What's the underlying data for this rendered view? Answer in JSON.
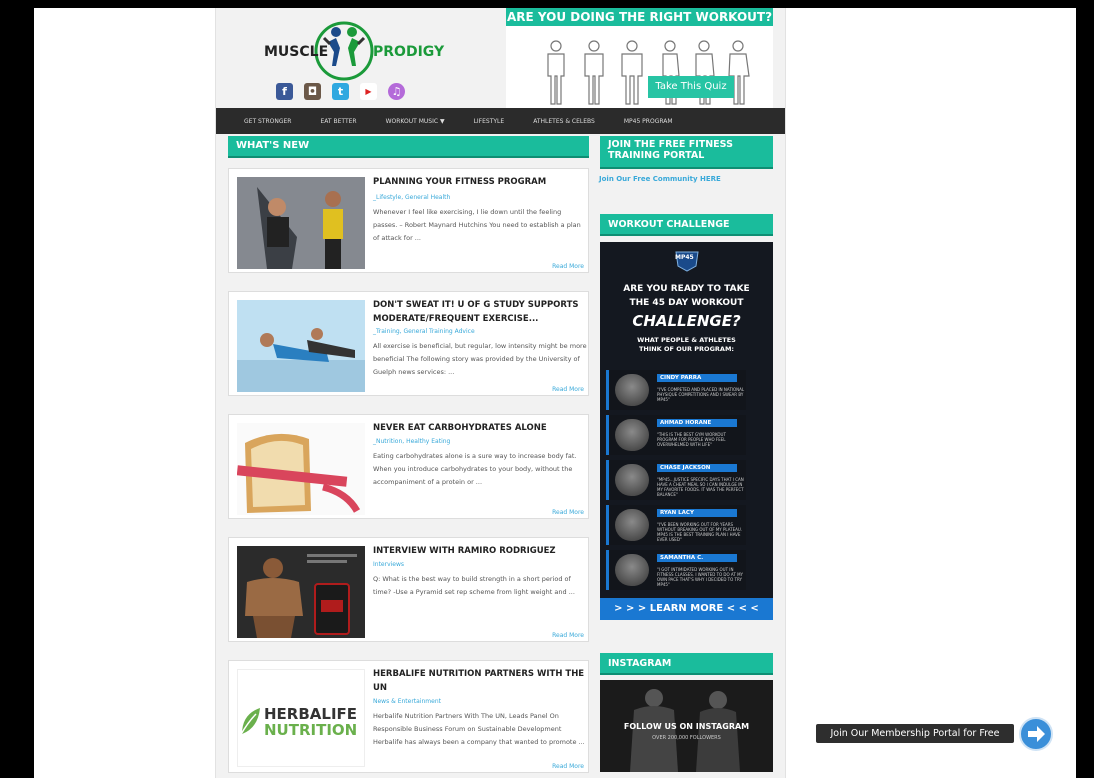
{
  "header": {
    "logo_word1": "MUSCLE",
    "logo_word2": "PRODIGY",
    "social_icons": [
      "facebook-icon",
      "instagram-icon",
      "twitter-icon",
      "youtube-icon",
      "itunes-icon"
    ],
    "quiz_banner": {
      "title": "ARE YOU DOING THE RIGHT WORKOUT?",
      "button_label": "Take This Quiz"
    }
  },
  "nav": {
    "items": [
      "GET STRONGER",
      "EAT BETTER",
      "WORKOUT MUSIC  ▼",
      "LIFESTYLE",
      "ATHLETES & CELEBS",
      "MP45 PROGRAM"
    ]
  },
  "main": {
    "section_title": "WHAT'S NEW",
    "posts": [
      {
        "title": "PLANNING YOUR FITNESS PROGRAM",
        "categories": "_Lifestyle, General Health",
        "excerpt": "Whenever I feel like exercising, I lie down until the feeling passes. – Robert Maynard Hutchins You need to establish a plan of attack for ...",
        "more": "Read More"
      },
      {
        "title": "DON'T SWEAT IT! U OF G STUDY SUPPORTS MODERATE/FREQUENT EXERCISE...",
        "categories": "_Training, General Training Advice",
        "excerpt": "All exercise is beneficial, but regular, low intensity might be more beneficial  The following story was provided by the University of Guelph news services: ...",
        "more": "Read More"
      },
      {
        "title": "NEVER EAT CARBOHYDRATES ALONE",
        "categories": "_Nutrition, Healthy Eating",
        "excerpt": "Eating carbohydrates alone is a sure way to increase body fat. When you introduce carbohydrates to your body, without the accompaniment of a protein or ...",
        "more": "Read More"
      },
      {
        "title": "INTERVIEW WITH RAMIRO RODRIGUEZ",
        "categories": "Interviews",
        "excerpt": "Q: What is the best way to build strength in a short period of time? -Use a Pyramid set rep scheme from light weight and ...",
        "more": "Read More"
      },
      {
        "title": "HERBALIFE NUTRITION PARTNERS WITH THE UN",
        "categories": "News & Entertainment",
        "excerpt": "Herbalife Nutrition Partners With The UN, Leads Panel On Responsible Business Forum on Sustainable Development Herbalife has always been a company that wanted to promote ...",
        "more": "Read More",
        "thumb_line1": "HERBALIFE",
        "thumb_line2": "NUTRITION"
      }
    ]
  },
  "sidebar": {
    "portal_title": "JOIN THE FREE FITNESS TRAINING PORTAL",
    "portal_link": "Join Our Free Community HERE",
    "challenge_title": "WORKOUT CHALLENGE",
    "challenge_ad": {
      "badge": "MP45",
      "line1": "ARE YOU READY TO TAKE",
      "line2": "THE 45 DAY WORKOUT",
      "line3": "CHALLENGE?",
      "line4": "WHAT PEOPLE & ATHLETES",
      "line5": "THINK OF OUR PROGRAM:",
      "testimonials": [
        {
          "name": "CINDY PARRA",
          "quote": "\"I'VE COMPETED AND PLACED IN NATIONAL PHYSIQUE COMPETITIONS AND I SWEAR BY MP45\""
        },
        {
          "name": "AHMAD HORANE",
          "quote": "\"THIS IS THE BEST GYM WORKOUT PROGRAM FOR PEOPLE WHO FEEL OVERWHELMED WITH LIFE\""
        },
        {
          "name": "CHASE JACKSON",
          "quote": "\"MP45...JUSTICE SPECIFIC DAYS THAT I CAN HAVE A CHEAT MEAL SO I CAN INDULGE IN MY FAVORITE FOODS. IT WAS THE PERFECT BALANCE\""
        },
        {
          "name": "RYAN LACY",
          "quote": "\"I'VE BEEN WORKING OUT FOR YEARS WITHOUT BREAKING OUT OF MY PLATEAU. MP45 IS THE BEST TRAINING PLAN I HAVE EVER USED\""
        },
        {
          "name": "SAMANTHA C.",
          "quote": "\"I GOT INTIMIDATED WORKING OUT IN FITNESS CLASSES. I WANTED TO DO AT MY OWN PACE THAT'S WHY I DECIDED TO TRY MP45\""
        }
      ],
      "cta": "> > > LEARN MORE < < <"
    },
    "instagram_title": "INSTAGRAM",
    "instagram_line1": "FOLLOW US ON INSTAGRAM",
    "instagram_line2": "OVER 200,000 FOLLOWERS"
  },
  "membership": {
    "label": "Join Our Membership Portal for Free"
  },
  "colors": {
    "accent": "#1abc9c",
    "link": "#39a9d9",
    "nav_bg": "#2b2b2b",
    "challenge_blue": "#1a78d2"
  }
}
